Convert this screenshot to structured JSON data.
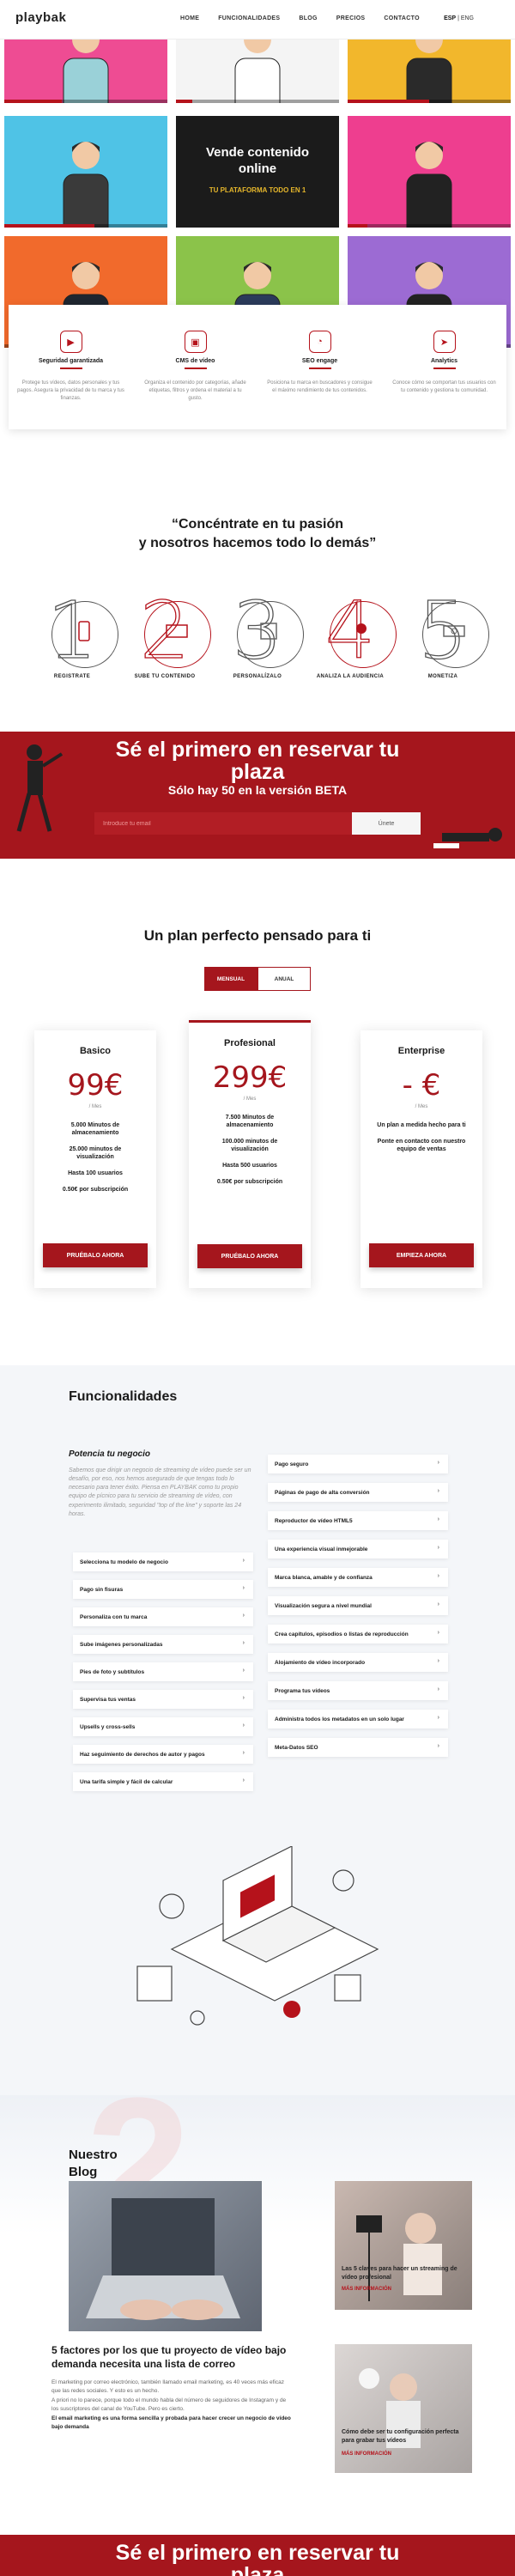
{
  "header": {
    "logo": "playbak",
    "nav": [
      "HOME",
      "FUNCIONALIDADES",
      "BLOG",
      "PRECIOS",
      "CONTACTO"
    ],
    "lang_active": "ESP",
    "lang_other": "| ENG"
  },
  "hero": {
    "title_line1": "Vende contenido",
    "title_line2": "online",
    "subtitle": "TU PLATAFORMA TODO EN 1",
    "tiles": [
      {
        "bg": "#ee4c93",
        "shirt": "#9ad1d8",
        "progress": 0.35
      },
      {
        "bg": "#f4f4f4",
        "shirt": "#ffffff",
        "progress": 0.1
      },
      {
        "bg": "#f2b72c",
        "shirt": "#2a2a2a",
        "progress": 0.5
      },
      {
        "bg": "#4fc3e6",
        "shirt": "#3a3a3a",
        "progress": 0.55
      },
      {
        "bg": "#1b1b1b",
        "shirt": "#1b1b1b",
        "progress": 0
      },
      {
        "bg": "#ee3e8f",
        "shirt": "#222222",
        "progress": 0.12
      },
      {
        "bg": "#f16a2c",
        "shirt": "#1f2630",
        "progress": 0
      },
      {
        "bg": "#8bc34a",
        "shirt": "#2b3b5a",
        "progress": 0
      },
      {
        "bg": "#9c6bd3",
        "shirt": "#222222",
        "progress": 0
      }
    ]
  },
  "features": [
    {
      "icon": "video-icon",
      "title": "Seguridad garantizada",
      "text": "Protege tus vídeos, datos personales y tus pagos. Asegura la privacidad de tu marca y tus finanzas."
    },
    {
      "icon": "cms-icon",
      "title": "CMS de vídeo",
      "text": "Organiza el contenido por categorías, añade etiquetas, filtros y ordena el material a tu gusto."
    },
    {
      "icon": "seo-icon",
      "title": "SEO engage",
      "text": "Posiciona tu marca en buscadores y consigue el máximo rendimiento de tus contenidos."
    },
    {
      "icon": "analytics-icon",
      "title": "Analytics",
      "text": "Conoce cómo se comportan tus usuarios con tu contenido y gestiona tu comunidad."
    }
  ],
  "quote": {
    "line1": "“Concéntrate en tu pasión",
    "line2": "y nosotros hacemos todo lo demás”"
  },
  "steps": [
    {
      "num": "1",
      "label": "REGISTRATE"
    },
    {
      "num": "2",
      "label": "SUBE TU CONTENIDO"
    },
    {
      "num": "3",
      "label": "PERSONALÍZALO"
    },
    {
      "num": "4",
      "label": "ANALIZA LA AUDIENCIA"
    },
    {
      "num": "5",
      "label": "MONETIZA"
    }
  ],
  "beta": {
    "title_line1": "Sé el primero en reservar tu",
    "title_line2": "plaza",
    "subtitle": "Sólo hay 50 en la versión BETA",
    "email_placeholder": "Introduce tu email",
    "button": "Únete"
  },
  "pricing": {
    "title": "Un plan perfecto pensado para ti",
    "toggle_monthly": "MENSUAL",
    "toggle_annual": "ANUAL",
    "plans": [
      {
        "name": "Basico",
        "price": "99€",
        "per": "/ Mes",
        "items": [
          "5.000 Minutos de almacenamiento",
          "25.000 minutos de visualización",
          "Hasta 100 usuarios",
          "0.50€ por subscripción"
        ],
        "cta": "PRUÉBALO AHORA"
      },
      {
        "name": "Profesional",
        "price": "299€",
        "per": "/ Mes",
        "items": [
          "7.500 Minutos de almacenamiento",
          "100.000 minutos de visualización",
          "Hasta 500 usuarios",
          "0.50€ por subscripción"
        ],
        "cta": "PRUÉBALO AHORA"
      },
      {
        "name": "Enterprise",
        "price": "- €",
        "per": "/ Mes",
        "items": [
          "Un plan a medida hecho para ti",
          "Ponte en contacto con nuestro equipo de ventas"
        ],
        "cta": "EMPIEZA AHORA"
      }
    ]
  },
  "funcionalidades": {
    "title": "Funcionalidades",
    "subtitle": "Potencia tu negocio",
    "description": "Sabemos que dirigir un negocio de streaming de vídeo puede ser un desafío, por eso, nos hemos asegurado de que tengas todo lo necesario para tener éxito. Piensa en PLAYBAK como tu propio equipo de pícnico para tu servicio de streaming de vídeo, con experimento ilimitado, seguridad \"top of the line\" y soporte las 24 horas.",
    "left_items": [
      "Selecciona tu modelo de negocio",
      "Pago sin fisuras",
      "Personaliza con tu marca",
      "Sube imágenes personalizadas",
      "Pies de foto y subtítulos",
      "Supervisa tus ventas",
      "Upsells y cross-sells",
      "Haz seguimiento de derechos de autor y pagos",
      "Una tarifa simple y fácil de calcular"
    ],
    "right_items": [
      "Pago seguro",
      "Páginas de pago de alta conversión",
      "Reproductor de vídeo HTML5",
      "Una experiencia visual inmejorable",
      "Marca blanca, amable y de confianza",
      "Visualización segura a nivel mundial",
      "Crea capítulos, episodios o listas de reproducción",
      "Alojamiento de vídeo incorporado",
      "Programa tus vídeos",
      "Administra todos los metadatos en un solo lugar",
      "Meta-Datos SEO"
    ]
  },
  "blog": {
    "title_line1": "Nuestro",
    "title_line2": "Blog",
    "main_title": "5 factores por los que tu proyecto de vídeo bajo demanda necesita una lista de correo",
    "main_p1": "El marketing por correo electrónico, también llamado email marketing, es 40 veces más eficaz que las redes sociales. Y esto es un hecho.",
    "main_p2": "A priori no lo parece, porque todo el mundo habla del número de seguidores de Instagram y de los suscriptores del canal de YouTube. Pero es cierto.",
    "main_p3": "El email marketing es una forma sencilla y probada para hacer crecer un negocio de vídeo bajo demanda",
    "side1_title": "Las 5 claves para hacer un streaming de vídeo profesional",
    "side1_more": "MÁS INFORMACIÓN",
    "side2_title": "Cómo debe ser tu configuración perfecta para grabar tus vídeos",
    "side2_more": "MÁS INFORMACIÓN"
  },
  "beta2": {
    "title_line1": "Sé el primero en reservar tu",
    "title_line2": "plaza"
  }
}
